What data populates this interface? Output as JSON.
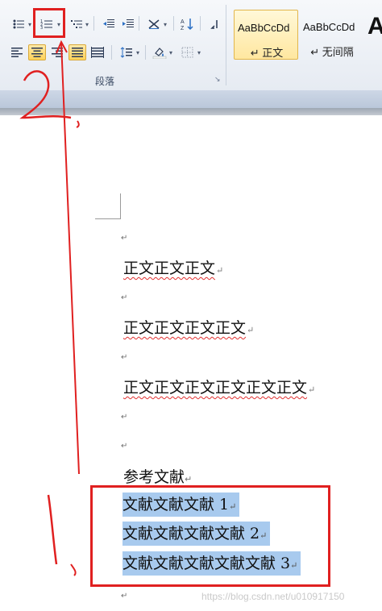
{
  "ribbon": {
    "group_label": "段落",
    "launcher_glyph": "↘",
    "styles": [
      {
        "sample": "AaBbCcDd",
        "name": "↵ 正文",
        "selected": true
      },
      {
        "sample": "AaBbCcDd",
        "name": "↵ 无间隔",
        "selected": false
      }
    ],
    "big_style_letter": "A",
    "icons": [
      "bullets-icon",
      "numbering-icon",
      "multilevel-list-icon",
      "decrease-indent-icon",
      "increase-indent-icon",
      "chinese-layout-icon",
      "sort-icon",
      "show-marks-icon",
      "align-left-icon",
      "align-center-icon",
      "align-right-icon",
      "justify-icon",
      "distributed-icon",
      "line-spacing-icon",
      "shading-icon",
      "borders-icon"
    ]
  },
  "document": {
    "paragraph_mark": "↵",
    "body_lines": [
      "正文正文正文",
      "正文正文正文正文",
      "正文正文正文正文正文正文"
    ],
    "heading": "参考文献",
    "references": [
      "文献文献文献 1",
      "文献文献文献文献 2",
      "文献文献文献文献文献 3"
    ]
  },
  "annotations": {
    "label_1": "1.",
    "label_2": "2."
  },
  "watermark": "https://blog.csdn.net/u010917150"
}
